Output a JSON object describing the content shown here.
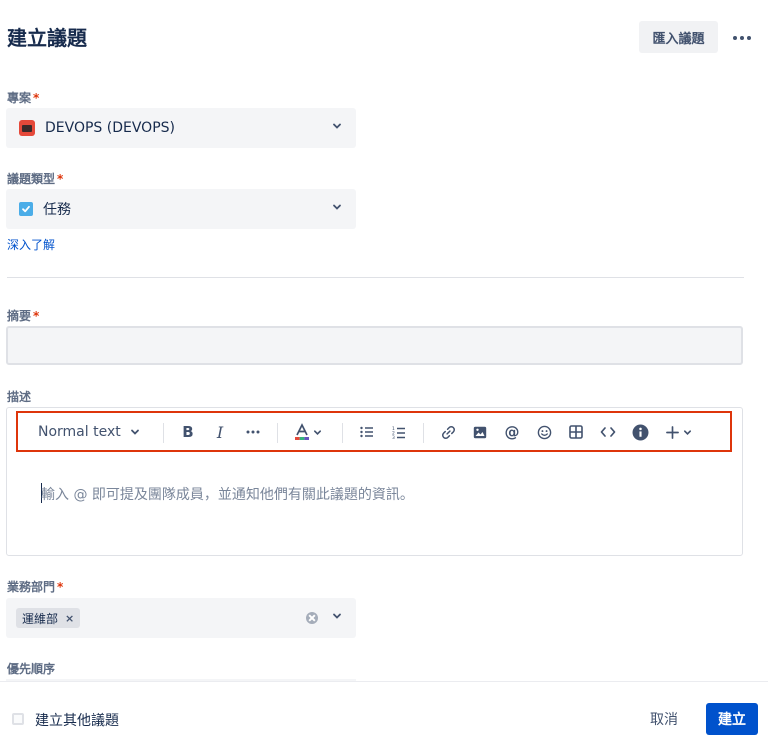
{
  "header": {
    "title": "建立議題",
    "import_label": "匯入議題",
    "more_icon": "more-horizontal-icon"
  },
  "project": {
    "label": "專案",
    "required_mark": "*",
    "value": "DEVOPS (DEVOPS)",
    "icon": "project-avatar-icon"
  },
  "issue_type": {
    "label": "議題類型",
    "required_mark": "*",
    "value": "任務",
    "icon": "task-checkbox-icon",
    "learn_more": "深入了解"
  },
  "summary": {
    "label": "摘要",
    "required_mark": "*",
    "value": ""
  },
  "description": {
    "label": "描述",
    "toolbar": {
      "text_style": "Normal text",
      "buttons": [
        "bold-icon",
        "italic-icon",
        "more-formatting-icon",
        "text-color-icon",
        "bullet-list-icon",
        "numbered-list-icon",
        "link-icon",
        "image-icon",
        "mention-icon",
        "emoji-icon",
        "table-icon",
        "code-icon",
        "info-icon",
        "insert-plus-icon"
      ]
    },
    "placeholder": "輸入 @ 即可提及團隊成員，並通知他們有關此議題的資訊。"
  },
  "department": {
    "label": "業務部門",
    "required_mark": "*",
    "tags": [
      "運維部"
    ],
    "tag_remove": "×"
  },
  "priority": {
    "label": "優先順序"
  },
  "footer": {
    "create_another": "建立其他議題",
    "cancel": "取消",
    "create": "建立"
  },
  "colors": {
    "primary": "#0052cc",
    "required": "#de350b",
    "highlight_border": "#de350b",
    "field_bg": "#f4f5f7"
  }
}
